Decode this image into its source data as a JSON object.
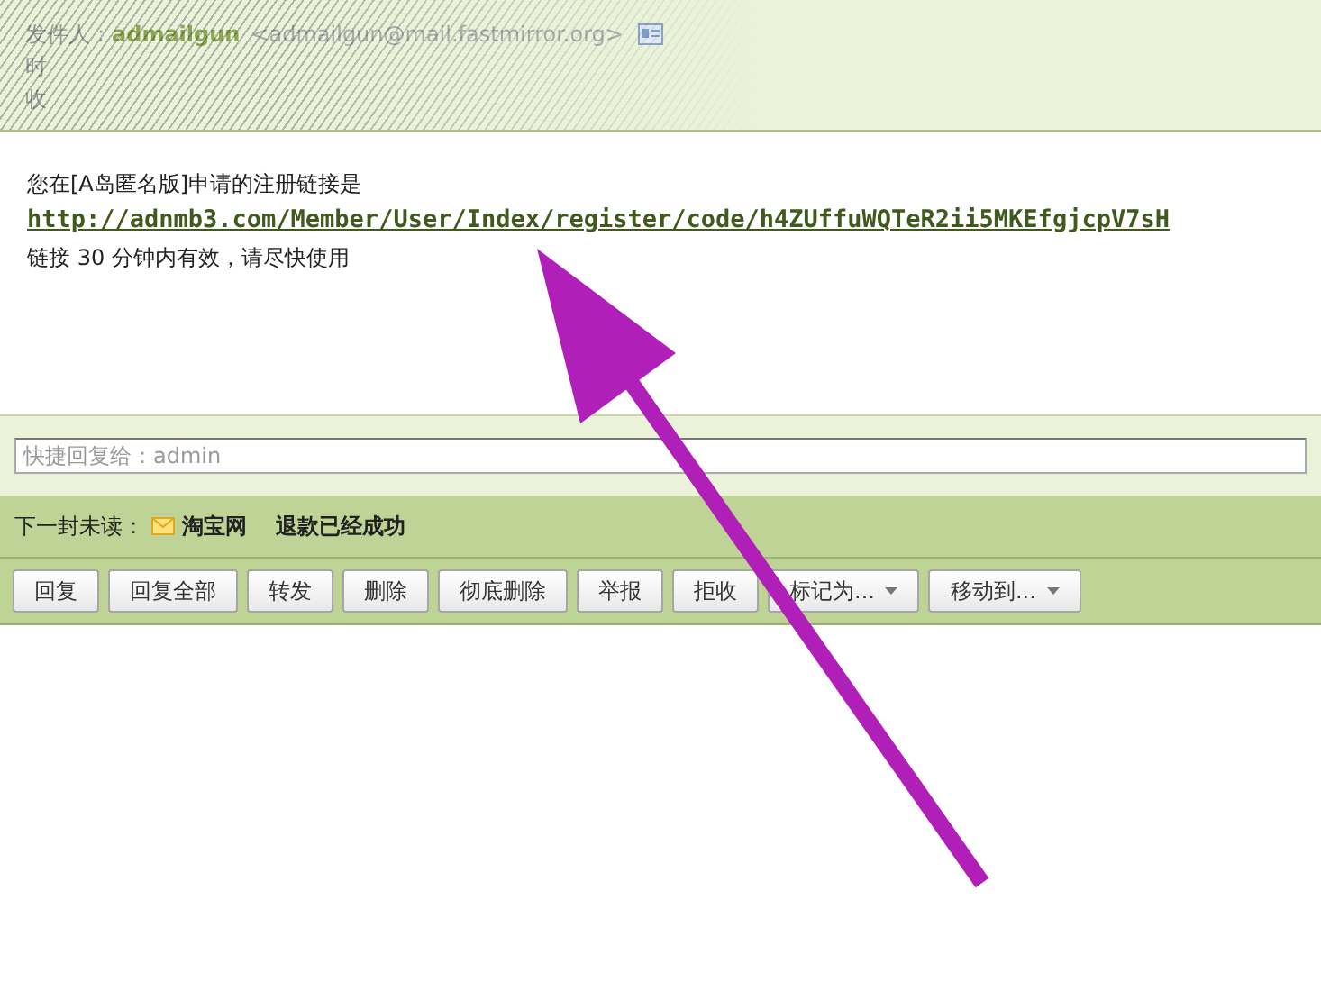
{
  "header": {
    "from_label": "发件人：",
    "sender_name": "admailgun",
    "sender_address": "<admailgun@mail.fastmirror.org>",
    "time_label": "时",
    "to_label": "收"
  },
  "body": {
    "intro": "您在[A岛匿名版]申请的注册链接是",
    "link": "http://adnmb3.com/Member/User/Index/register/code/h4ZUffuWQTeR2ii5MKEfgjcpV7sH",
    "note": "链接 30 分钟内有效，请尽快使用"
  },
  "quick_reply": {
    "placeholder": "快捷回复给：admin"
  },
  "next_unread": {
    "label": "下一封未读：",
    "sender": "淘宝网",
    "subject": "退款已经成功"
  },
  "toolbar": [
    {
      "label": "回复",
      "kind": "plain"
    },
    {
      "label": "回复全部",
      "kind": "plain"
    },
    {
      "label": "转发",
      "kind": "plain"
    },
    {
      "label": "删除",
      "kind": "plain"
    },
    {
      "label": "彻底删除",
      "kind": "plain"
    },
    {
      "label": "举报",
      "kind": "plain"
    },
    {
      "label": "拒收",
      "kind": "plain"
    },
    {
      "label": "标记为...",
      "kind": "dropdown"
    },
    {
      "label": "移动到...",
      "kind": "dropdown"
    }
  ]
}
